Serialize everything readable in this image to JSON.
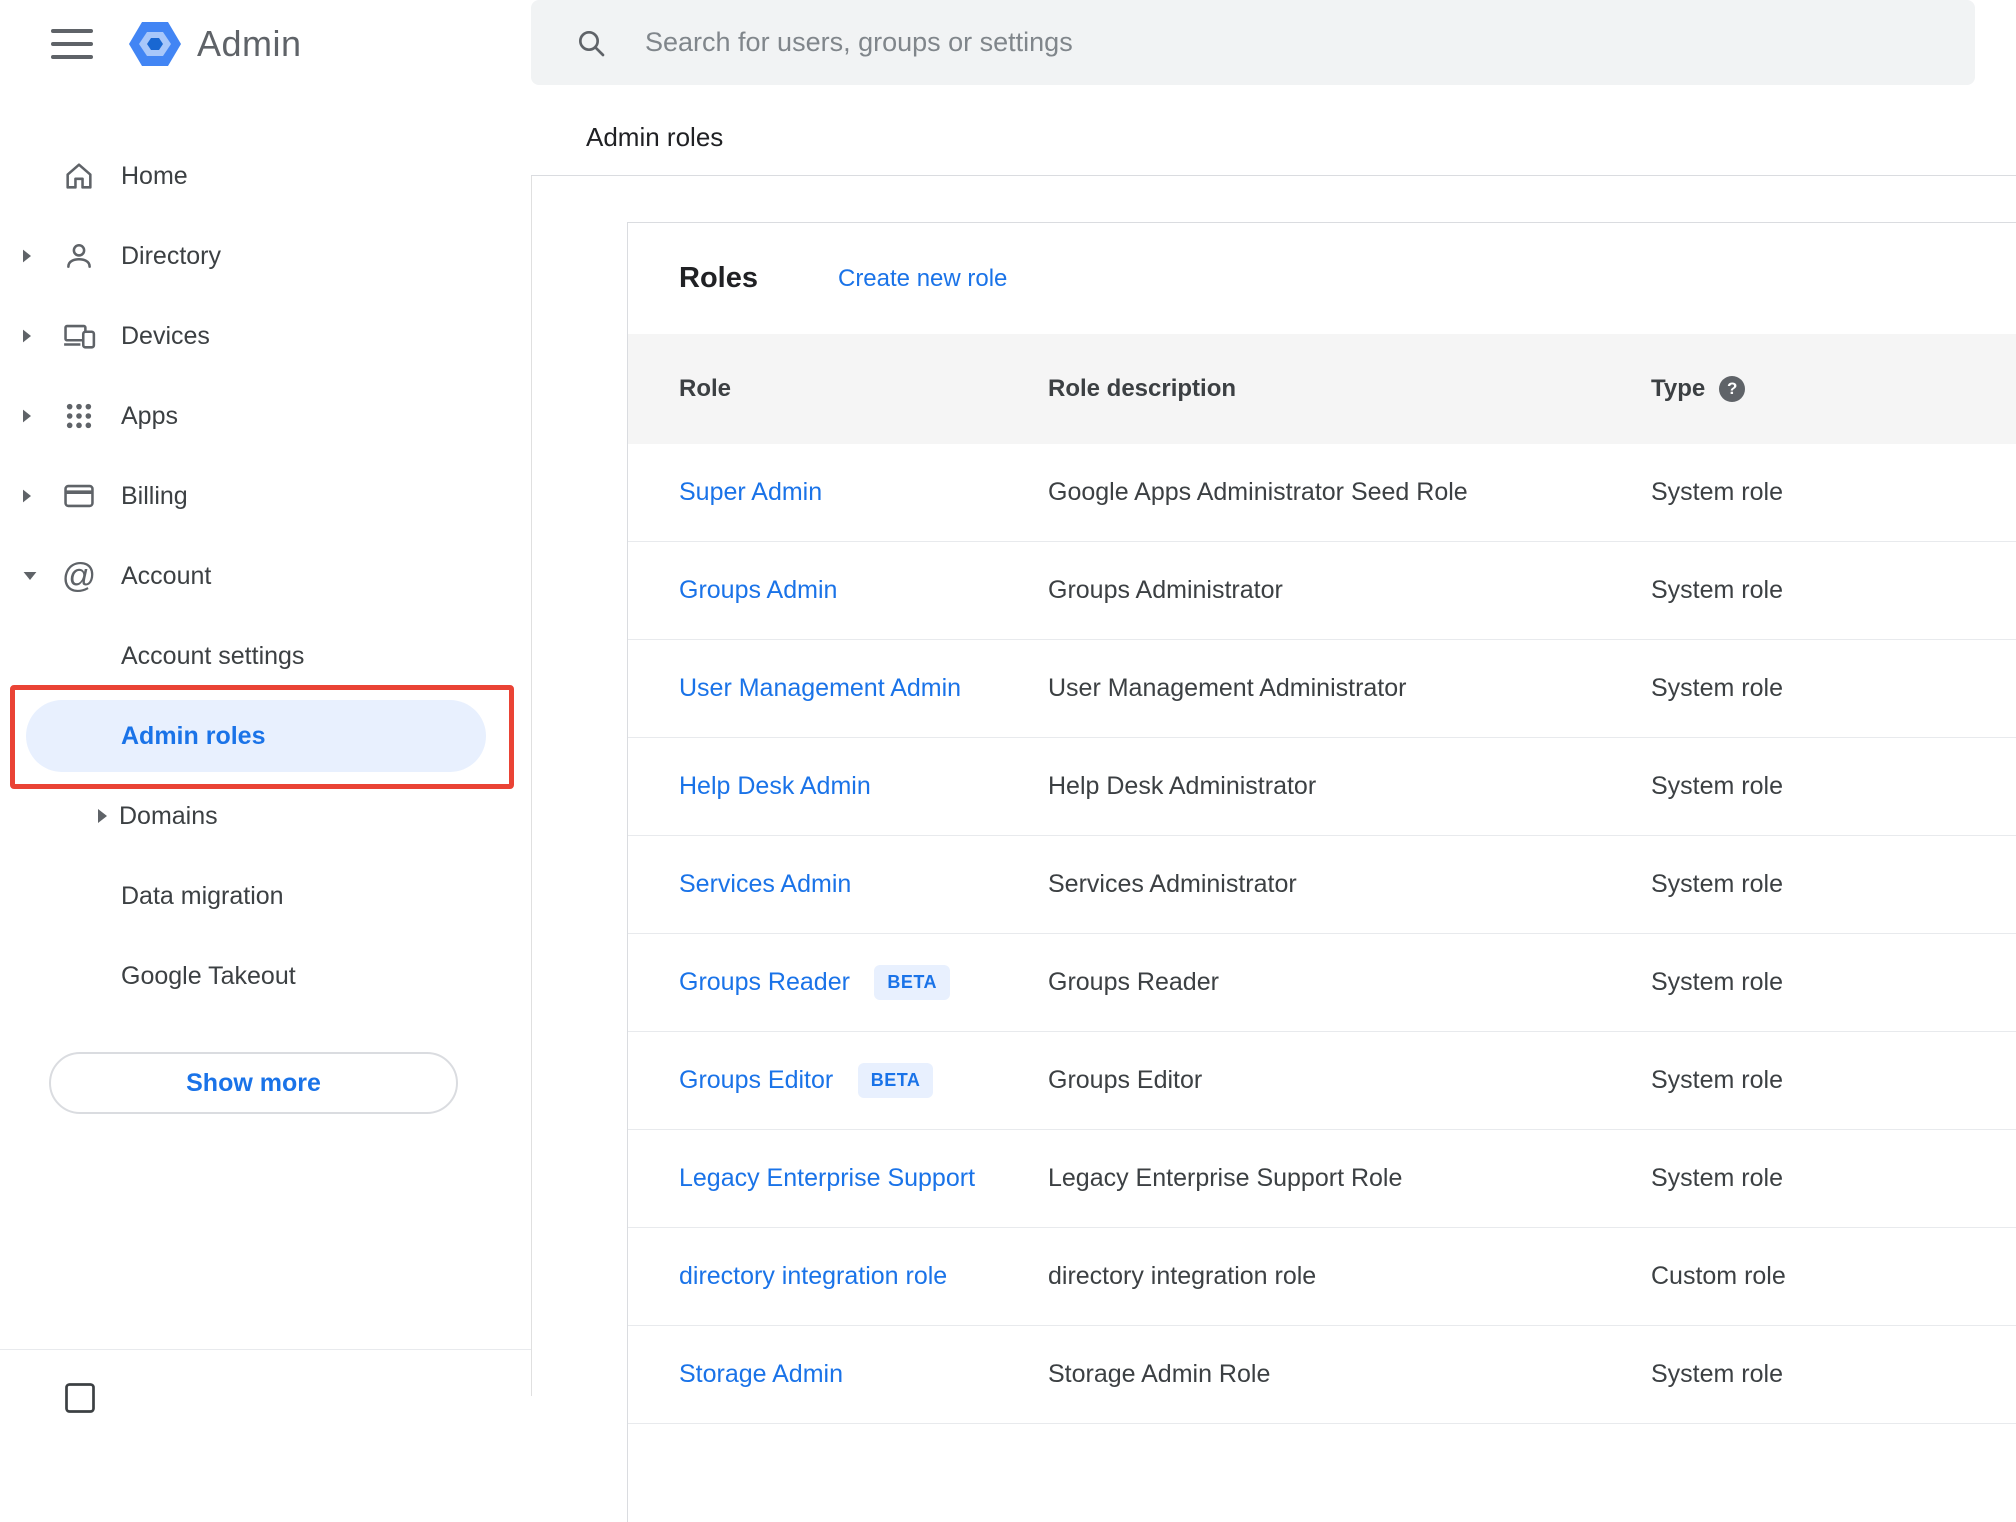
{
  "app": {
    "title": "Admin"
  },
  "icons": {
    "at": "@",
    "help": "?"
  },
  "sidebar": {
    "items": [
      {
        "label": "Home"
      },
      {
        "label": "Directory"
      },
      {
        "label": "Devices"
      },
      {
        "label": "Apps"
      },
      {
        "label": "Billing"
      },
      {
        "label": "Account"
      }
    ],
    "account_children": [
      {
        "label": "Account settings"
      },
      {
        "label": "Admin roles"
      },
      {
        "label": "Domains"
      },
      {
        "label": "Data migration"
      },
      {
        "label": "Google Takeout"
      }
    ],
    "show_more": "Show more"
  },
  "search": {
    "placeholder": "Search for users, groups or settings"
  },
  "breadcrumb": {
    "label": "Admin roles"
  },
  "roles": {
    "title": "Roles",
    "create_link": "Create new role",
    "columns": {
      "role": "Role",
      "description": "Role description",
      "type": "Type"
    },
    "beta_badge": "BETA",
    "rows": [
      {
        "role": "Super Admin",
        "description": "Google Apps Administrator Seed Role",
        "type": "System role"
      },
      {
        "role": "Groups Admin",
        "description": "Groups Administrator",
        "type": "System role"
      },
      {
        "role": "User Management Admin",
        "description": "User Management Administrator",
        "type": "System role"
      },
      {
        "role": "Help Desk Admin",
        "description": "Help Desk Administrator",
        "type": "System role"
      },
      {
        "role": "Services Admin",
        "description": "Services Administrator",
        "type": "System role"
      },
      {
        "role": "Groups Reader",
        "description": "Groups Reader",
        "type": "System role"
      },
      {
        "role": "Groups Editor",
        "description": "Groups Editor",
        "type": "System role"
      },
      {
        "role": "Legacy Enterprise Support",
        "description": "Legacy Enterprise Support Role",
        "type": "System role"
      },
      {
        "role": "directory integration role",
        "description": "directory integration role",
        "type": "Custom role"
      },
      {
        "role": "Storage Admin",
        "description": "Storage Admin Role",
        "type": "System role"
      }
    ]
  },
  "colors": {
    "accent": "#1a73e8",
    "selected_bg": "#e8f0fe",
    "annotation_red": "#ea4335",
    "search_bg": "#f1f3f4",
    "table_header_bg": "#f5f5f5"
  }
}
